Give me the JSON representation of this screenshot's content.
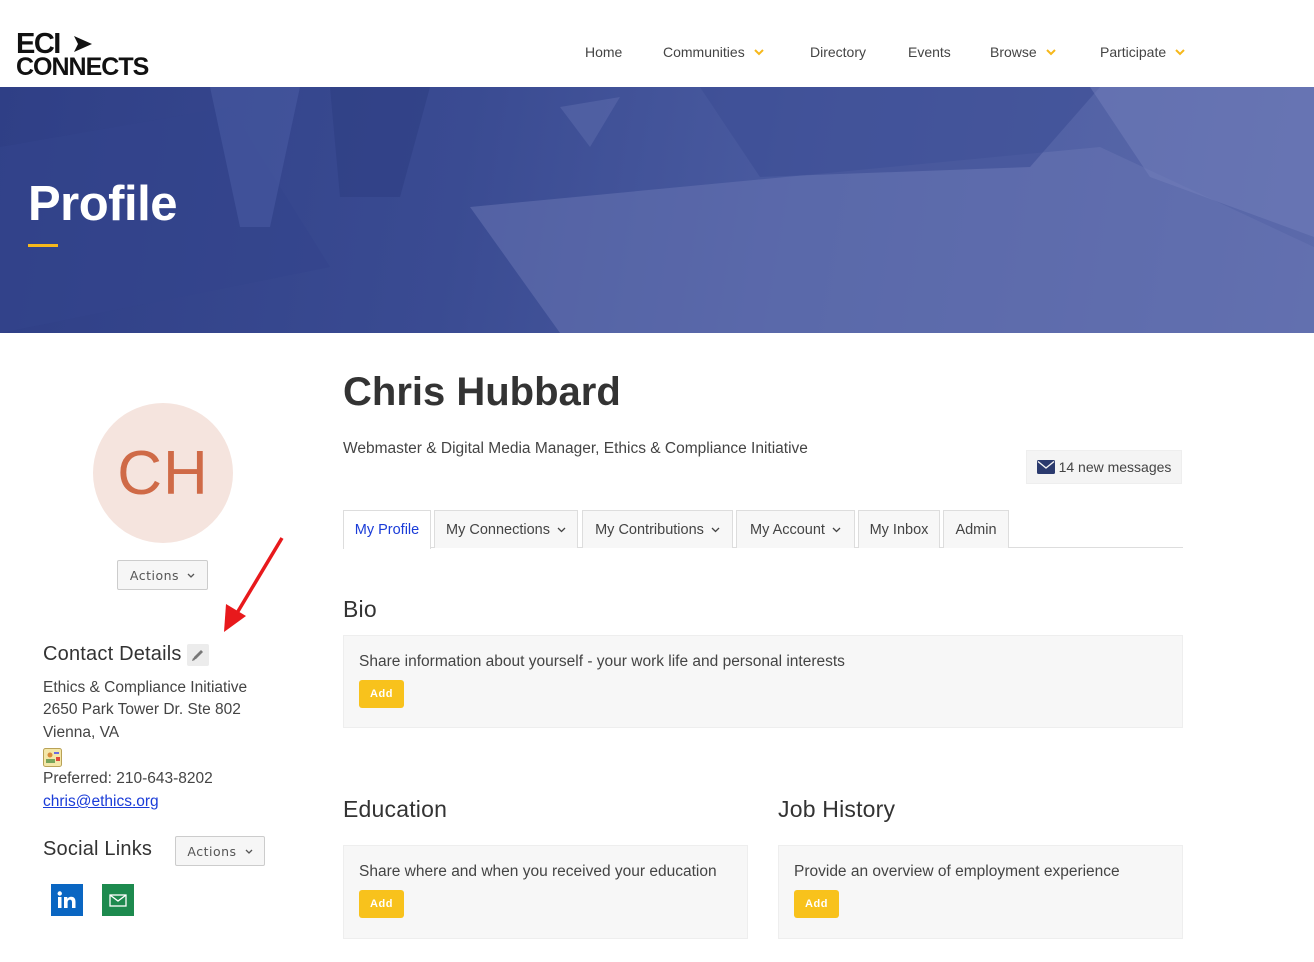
{
  "brand": {
    "logo_top": "ECI",
    "logo_bottom": "CONNECTS",
    "accent": "#f6b81c",
    "link_color": "#1a3cd8"
  },
  "nav": {
    "items": [
      {
        "label": "Home",
        "has_dropdown": false
      },
      {
        "label": "Communities",
        "has_dropdown": true
      },
      {
        "label": "Directory",
        "has_dropdown": false
      },
      {
        "label": "Events",
        "has_dropdown": false
      },
      {
        "label": "Browse",
        "has_dropdown": true
      },
      {
        "label": "Participate",
        "has_dropdown": true
      }
    ]
  },
  "hero": {
    "title": "Profile"
  },
  "profile": {
    "initials": "CH",
    "actions_label": "Actions",
    "name": "Chris Hubbard",
    "job_title": "Webmaster & Digital Media Manager, Ethics & Compliance Initiative",
    "messages": "14 new messages"
  },
  "contact": {
    "heading": "Contact Details",
    "organization": "Ethics & Compliance Initiative",
    "address": "2650 Park Tower Dr. Ste 802",
    "city": "Vienna, VA",
    "phone": "Preferred: 210-643-8202",
    "email": "chris@ethics.org"
  },
  "social": {
    "heading": "Social Links",
    "actions_label": "Actions",
    "icons": [
      "linkedin-icon",
      "email-icon"
    ]
  },
  "tabs": [
    {
      "label": "My Profile",
      "active": true,
      "has_dropdown": false
    },
    {
      "label": "My Connections",
      "active": false,
      "has_dropdown": true
    },
    {
      "label": "My Contributions",
      "active": false,
      "has_dropdown": true
    },
    {
      "label": "My Account",
      "active": false,
      "has_dropdown": true
    },
    {
      "label": "My Inbox",
      "active": false,
      "has_dropdown": false
    },
    {
      "label": "Admin",
      "active": false,
      "has_dropdown": false
    }
  ],
  "sections": {
    "bio": {
      "heading": "Bio",
      "text": "Share information about yourself - your work life and personal interests",
      "button": "Add"
    },
    "education": {
      "heading": "Education",
      "text": "Share where and when you received your education",
      "button": "Add"
    },
    "job_history": {
      "heading": "Job History",
      "text": "Provide an overview of employment experience",
      "button": "Add"
    }
  }
}
